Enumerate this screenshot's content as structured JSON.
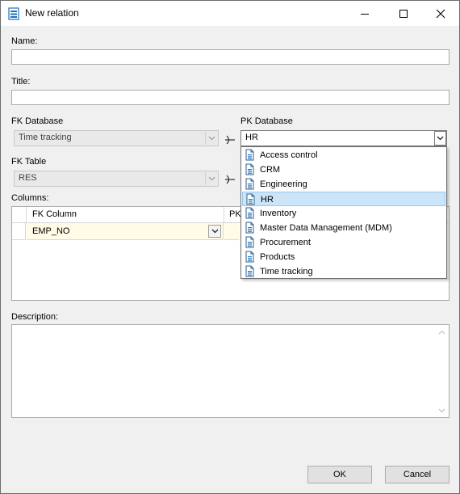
{
  "window": {
    "title": "New relation",
    "minimize_icon": "minimize-icon",
    "maximize_icon": "maximize-icon",
    "close_icon": "close-icon"
  },
  "form": {
    "name_label": "Name:",
    "name_value": "",
    "title_label": "Title:",
    "title_value": "",
    "fk_database_label": "FK Database",
    "fk_database_value": "Time tracking",
    "pk_database_label": "PK Database",
    "pk_database_value": "HR",
    "fk_table_label": "FK Table",
    "fk_table_value": "RES",
    "columns_label": "Columns:",
    "description_label": "Description:",
    "description_value": ""
  },
  "columns_grid": {
    "headers": [
      "FK Column",
      "PK"
    ],
    "rows": [
      {
        "fk_column": "EMP_NO",
        "pk_column": ""
      }
    ]
  },
  "pk_database_dropdown": {
    "options": [
      "Access control",
      "CRM",
      "Engineering",
      "HR",
      "Inventory",
      "Master Data Management (MDM)",
      "Procurement",
      "Products",
      "Time tracking"
    ],
    "selected_index": 3
  },
  "buttons": {
    "ok_label": "OK",
    "cancel_label": "Cancel"
  },
  "colors": {
    "selection": "#cce4f7",
    "fk_row_highlight": "#fffbe6",
    "accent": "#1e73be"
  }
}
